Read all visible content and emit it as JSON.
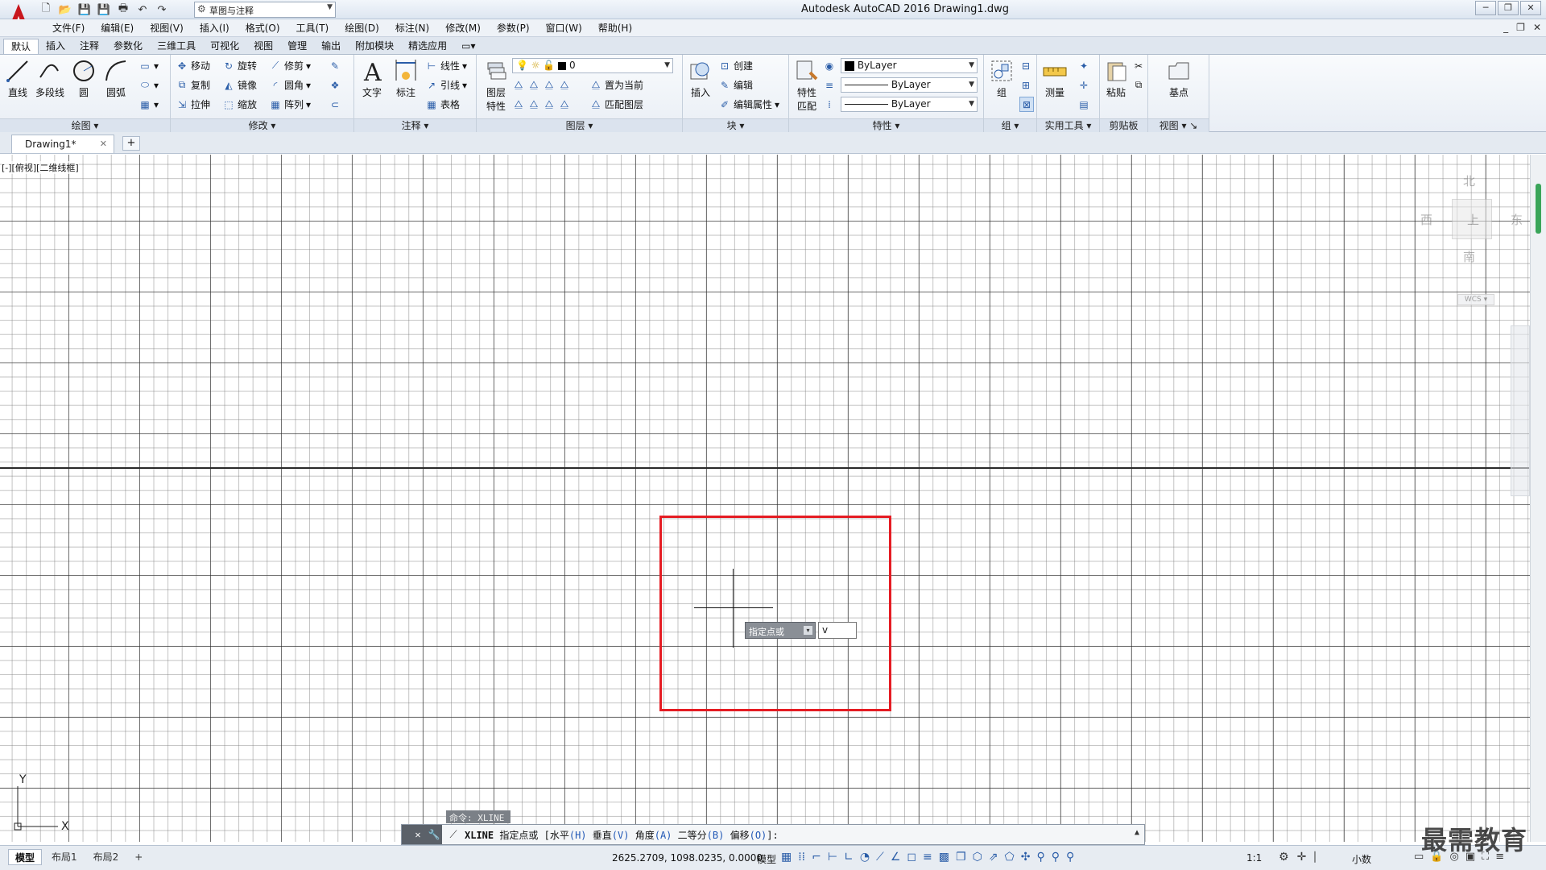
{
  "titlebar": {
    "workspace": "草图与注释",
    "title": "Autodesk AutoCAD 2016    Drawing1.dwg"
  },
  "menu": [
    "文件(F)",
    "编辑(E)",
    "视图(V)",
    "插入(I)",
    "格式(O)",
    "工具(T)",
    "绘图(D)",
    "标注(N)",
    "修改(M)",
    "参数(P)",
    "窗口(W)",
    "帮助(H)"
  ],
  "ribbon_tabs": [
    "默认",
    "插入",
    "注释",
    "参数化",
    "三维工具",
    "可视化",
    "视图",
    "管理",
    "输出",
    "附加模块",
    "精选应用"
  ],
  "ribbon": {
    "draw": {
      "title": "绘图",
      "line": "直线",
      "polyline": "多段线",
      "circle": "圆",
      "arc": "圆弧"
    },
    "modify": {
      "title": "修改",
      "move": "移动",
      "rotate": "旋转",
      "trim": "修剪",
      "copy": "复制",
      "mirror": "镜像",
      "fillet": "圆角",
      "stretch": "拉伸",
      "scale": "缩放",
      "array": "阵列"
    },
    "annotation": {
      "title": "注释",
      "text": "文字",
      "dimension": "标注",
      "linear": "线性",
      "leader": "引线",
      "table": "表格"
    },
    "layers": {
      "title": "图层",
      "layer_props": "图层\n特性",
      "layer_props_l1": "图层",
      "layer_props_l2": "特性",
      "current_layer": "0",
      "set_current": "置为当前",
      "match_layer": "匹配图层"
    },
    "block": {
      "title": "块",
      "insert": "插入",
      "create": "创建",
      "edit": "编辑",
      "edit_attr": "编辑属性"
    },
    "properties": {
      "title": "特性",
      "match_l1": "特性",
      "match_l2": "匹配",
      "color": "ByLayer",
      "linetype": "ByLayer",
      "lineweight": "ByLayer"
    },
    "groups": {
      "title": "组",
      "group": "组"
    },
    "utilities": {
      "title": "实用工具",
      "measure": "测量"
    },
    "clipboard": {
      "title": "剪贴板",
      "paste": "粘贴"
    },
    "view": {
      "title": "视图",
      "base": "基点"
    }
  },
  "doc_tab": {
    "name": "Drawing1*"
  },
  "canvas": {
    "viewport_label": "[-][俯视][二维线框]",
    "dynamic_prompt": "指定点或",
    "dynamic_input": "v"
  },
  "viewcube": {
    "north": "北",
    "south": "南",
    "east": "东",
    "west": "西",
    "top": "上",
    "wcs": "WCS"
  },
  "ucs": {
    "x": "X",
    "y": "Y"
  },
  "command": {
    "history": "命令: XLINE",
    "cmd": "XLINE",
    "prompt": "指定点或",
    "opt_h_label": "水平",
    "opt_h_key": "(H)",
    "opt_v_label": "垂直",
    "opt_v_key": "(V)",
    "opt_a_label": "角度",
    "opt_a_key": "(A)",
    "opt_b_label": "二等分",
    "opt_b_key": "(B)",
    "opt_o_label": "偏移",
    "opt_o_key": "(O)"
  },
  "status": {
    "layout_tabs": [
      "模型",
      "布局1",
      "布局2"
    ],
    "coords": "2625.2709, 1098.0235, 0.0000",
    "model": "模型",
    "scale": "1:1",
    "units": "小数"
  },
  "watermark": "最需教育"
}
